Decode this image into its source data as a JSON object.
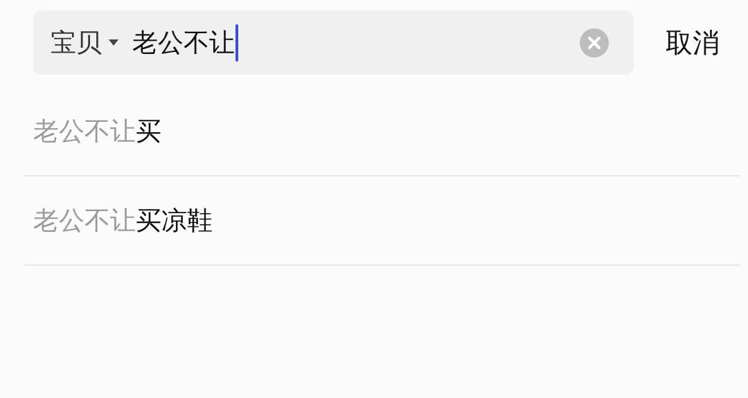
{
  "search": {
    "scope": "宝贝",
    "query": "老公不让",
    "focused": true
  },
  "cancel": "取消",
  "suggestions": [
    {
      "match": "老公不让",
      "rest": "买"
    },
    {
      "match": "老公不让",
      "rest": "买凉鞋"
    }
  ]
}
